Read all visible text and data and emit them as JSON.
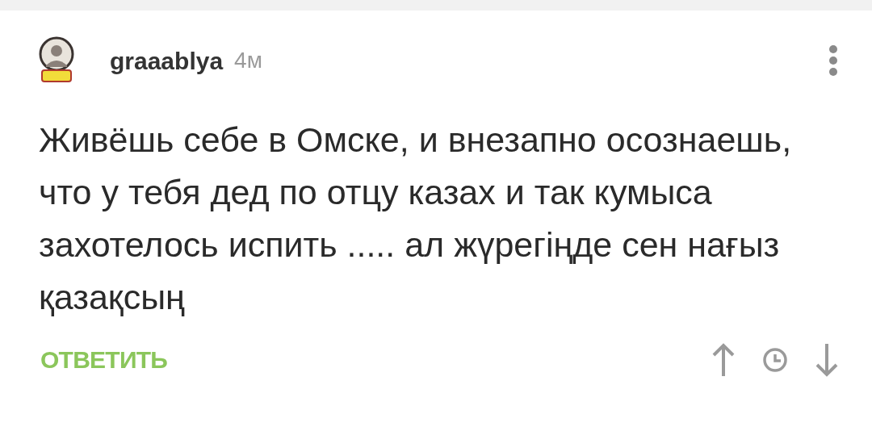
{
  "comment": {
    "author": "graaablya",
    "time": "4м",
    "text": "Живёшь себе в Омске, и внезапно осознаешь, что у тебя дед по отцу казах и так кумыса захотелось испить ..... ал жүрегіңде сен нағыз қазақсың"
  },
  "actions": {
    "reply": "ОТВЕТИТЬ"
  }
}
